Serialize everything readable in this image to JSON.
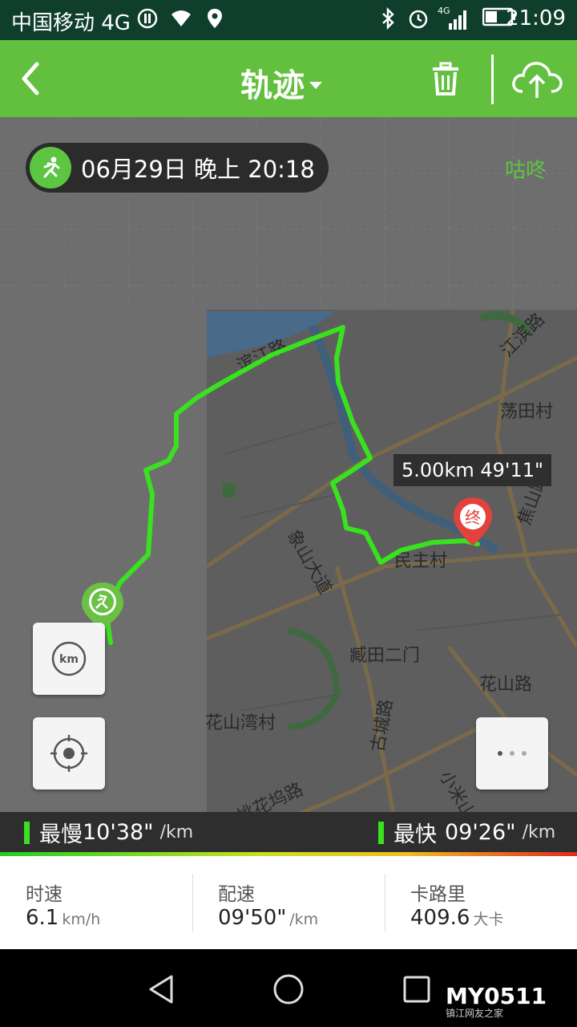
{
  "status_bar": {
    "carrier": "中国移动 4G",
    "network_right": "4G",
    "clock": "21:09"
  },
  "app_bar": {
    "title": "轨迹"
  },
  "map": {
    "date_time": "06月29日 晚上 20:18",
    "brand": "咕咚",
    "distance_time_label": "5.00km  49'11\"",
    "end_marker": "终",
    "km_button": "km",
    "street_labels": [
      "江滨路",
      "荡田村",
      "焦山路",
      "民主村",
      "象山大道",
      "臧田二门",
      "花山路",
      "花山湾村",
      "古城路",
      "桃花坞路",
      "小米山路",
      "滨江路"
    ]
  },
  "pace_bar": {
    "slowest_label": "最慢",
    "slowest_value": "10'38\"",
    "fastest_label": "最快",
    "fastest_value": "09'26\"",
    "unit": "/km"
  },
  "stats": [
    {
      "label": "时速",
      "value": "6.1",
      "unit": "km/h"
    },
    {
      "label": "配速",
      "value": "09'50\"",
      "unit": "/km"
    },
    {
      "label": "卡路里",
      "value": "409.6",
      "unit": "大卡"
    }
  ],
  "watermark": {
    "logo": "MY0511",
    "sub": "镇江网友之家"
  },
  "colors": {
    "accent": "#63c03f",
    "track": "#39e11f",
    "statusbar": "#0f3f2c"
  }
}
